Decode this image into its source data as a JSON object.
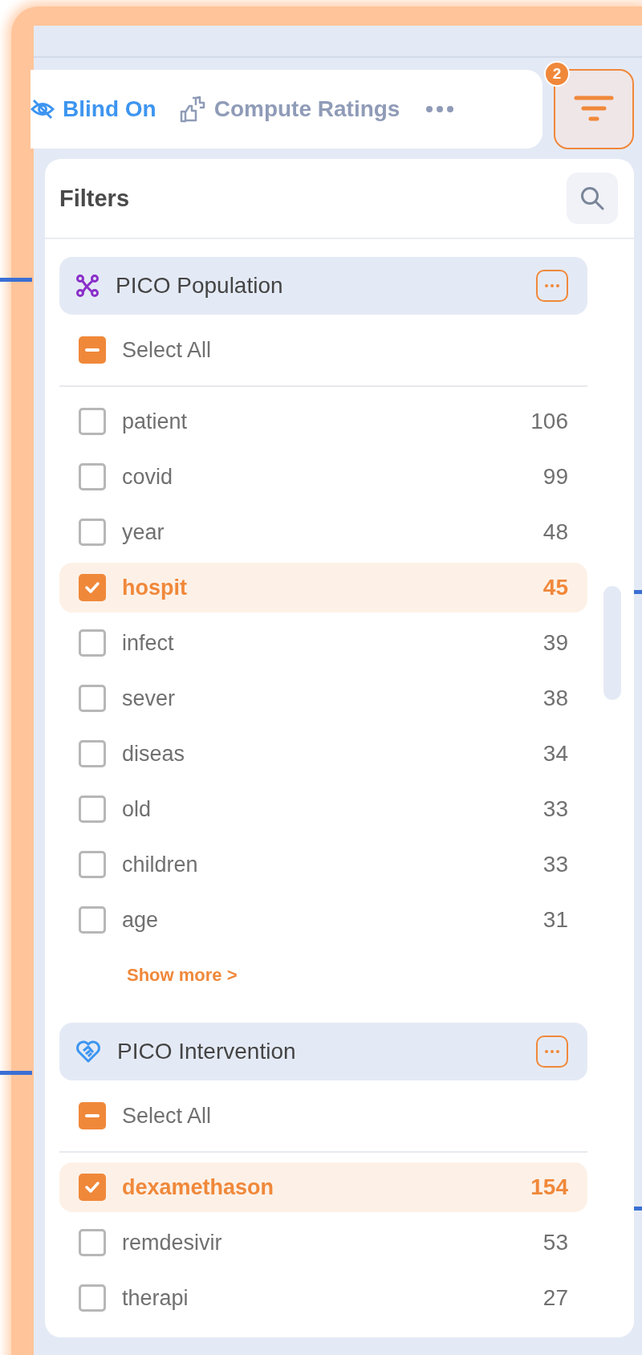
{
  "toolbar": {
    "actions": [
      {
        "kind": "toggle",
        "label": "Blind On",
        "on": true
      },
      {
        "kind": "action",
        "label": "Compute Ratings"
      }
    ]
  },
  "filter_button": {
    "badge": "2",
    "active": true
  },
  "panel": {
    "title": "Filters"
  },
  "groups": [
    {
      "kind": "population",
      "title": "PICO Population",
      "select_all": {
        "label": "Select All",
        "indeterminate": true
      },
      "items": [
        {
          "label": "patient",
          "count": "106",
          "checked": false
        },
        {
          "label": "covid",
          "count": "99",
          "checked": false
        },
        {
          "label": "year",
          "count": "48",
          "checked": false
        },
        {
          "label": "hospit",
          "count": "45",
          "checked": true
        },
        {
          "label": "infect",
          "count": "39",
          "checked": false
        },
        {
          "label": "sever",
          "count": "38",
          "checked": false
        },
        {
          "label": "diseas",
          "count": "34",
          "checked": false
        },
        {
          "label": "old",
          "count": "33",
          "checked": false
        },
        {
          "label": "children",
          "count": "33",
          "checked": false
        },
        {
          "label": "age",
          "count": "31",
          "checked": false
        }
      ],
      "show_more": "Show more >"
    },
    {
      "kind": "intervention",
      "title": "PICO Intervention",
      "select_all": {
        "label": "Select All",
        "indeterminate": true
      },
      "items": [
        {
          "label": "dexamethason",
          "count": "154",
          "checked": true
        },
        {
          "label": "remdesivir",
          "count": "53",
          "checked": false
        },
        {
          "label": "therapi",
          "count": "27",
          "checked": false
        }
      ]
    }
  ]
}
